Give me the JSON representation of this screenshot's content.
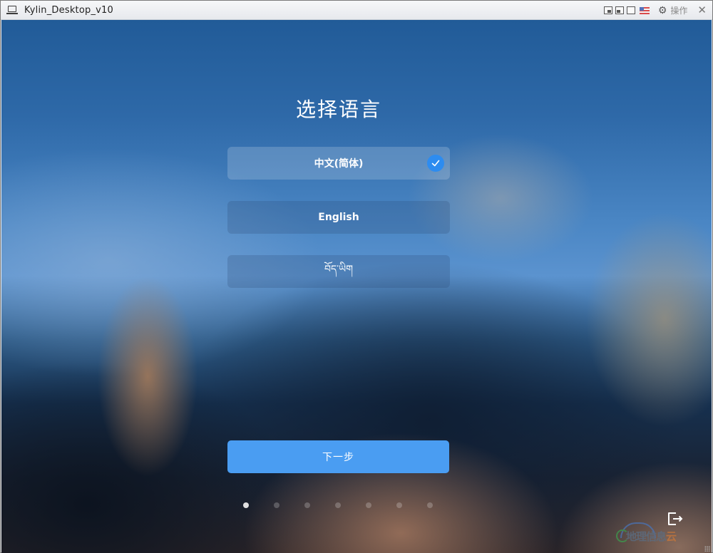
{
  "window": {
    "title": "Kylin_Desktop_v10",
    "app_icon": "laptop-icon",
    "toolbar": {
      "buttons": [
        {
          "name": "view-mode-1-icon"
        },
        {
          "name": "view-mode-2-icon"
        },
        {
          "name": "view-fullscreen-icon"
        },
        {
          "name": "keyboard-flag-icon"
        }
      ],
      "ops_icon": "gear-icon",
      "ops_label": "操作",
      "close_glyph": "✕"
    }
  },
  "installer": {
    "heading": "选择语言",
    "languages": [
      {
        "label": "中文(简体)",
        "selected": true
      },
      {
        "label": "English",
        "selected": false
      },
      {
        "label": "བོད་ཡིག",
        "selected": false
      }
    ],
    "next_label": "下一步",
    "steps": {
      "total": 7,
      "current": 1
    },
    "exit_icon": "exit-icon"
  },
  "watermark": {
    "text_main": "地理信息",
    "text_last": "云"
  },
  "colors": {
    "accent": "#4a9df2",
    "check": "#2d8cf0"
  }
}
